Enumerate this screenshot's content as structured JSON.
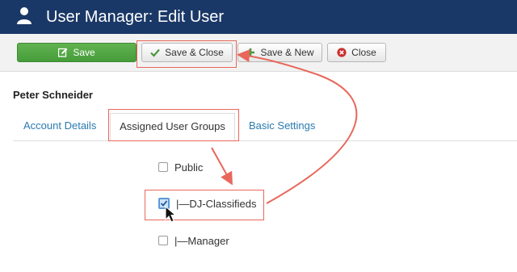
{
  "header": {
    "title": "User Manager: Edit User"
  },
  "toolbar": {
    "save": "Save",
    "save_close": "Save & Close",
    "save_new": "Save & New",
    "close": "Close"
  },
  "user": {
    "name": "Peter Schneider"
  },
  "tabs": [
    {
      "label": "Account Details"
    },
    {
      "label": "Assigned User Groups",
      "active": true
    },
    {
      "label": "Basic Settings"
    }
  ],
  "groups": [
    {
      "label": "Public",
      "checked": false
    },
    {
      "label": "|—DJ-Classifieds",
      "checked": true
    },
    {
      "label": "|—Manager",
      "checked": false
    }
  ],
  "colors": {
    "header_bg": "#1a3867",
    "save_green": "#469d3a",
    "annotation_red": "#e8675b",
    "link_blue": "#2a7ab0"
  },
  "icons": [
    "user-icon",
    "pencil-icon",
    "check-icon",
    "plus-icon",
    "close-circle-icon",
    "mouse-pointer-icon"
  ]
}
